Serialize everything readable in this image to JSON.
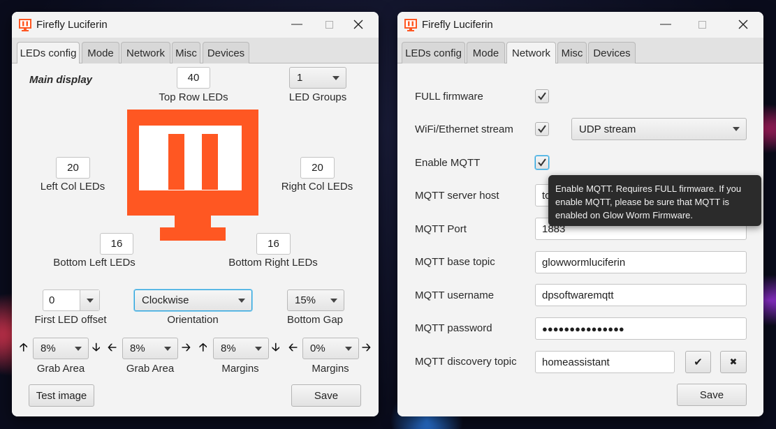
{
  "colors": {
    "brand": "#ff5722",
    "accent": "#2aa3dc"
  },
  "left_window": {
    "title": "Firefly Luciferin",
    "tabs": [
      "LEDs config",
      "Mode",
      "Network",
      "Misc",
      "Devices"
    ],
    "active_tab": "LEDs config",
    "main_display": "Main display",
    "top_row_leds": {
      "value": "40",
      "label": "Top Row LEDs"
    },
    "led_groups": {
      "value": "1",
      "label": "LED Groups"
    },
    "left_col_leds": {
      "value": "20",
      "label": "Left Col LEDs"
    },
    "right_col_leds": {
      "value": "20",
      "label": "Right Col LEDs"
    },
    "bottom_left_leds": {
      "value": "16",
      "label": "Bottom Left LEDs"
    },
    "bottom_right_leds": {
      "value": "16",
      "label": "Bottom Right LEDs"
    },
    "first_led_offset": {
      "value": "0",
      "label": "First LED offset"
    },
    "orientation": {
      "value": "Clockwise",
      "label": "Orientation"
    },
    "bottom_gap": {
      "value": "15%",
      "label": "Bottom Gap"
    },
    "grab_area_top": {
      "value": "8%",
      "label": "Grab Area"
    },
    "grab_area_left": {
      "value": "8%",
      "label": "Grab Area"
    },
    "margins_top": {
      "value": "8%",
      "label": "Margins"
    },
    "margins_left": {
      "value": "0%",
      "label": "Margins"
    },
    "arrows": {
      "up": "🡡",
      "down": "🡣",
      "left": "🡠",
      "right": "🡢"
    },
    "test_image_button": "Test image",
    "save_button": "Save"
  },
  "right_window": {
    "title": "Firefly Luciferin",
    "tabs": [
      "LEDs config",
      "Mode",
      "Network",
      "Misc",
      "Devices"
    ],
    "active_tab": "Network",
    "full_firmware_label": "FULL firmware",
    "full_firmware_checked": true,
    "wifi_stream_label": "WiFi/Ethernet stream",
    "wifi_stream_checked": true,
    "stream_type": "UDP stream",
    "enable_mqtt_label": "Enable MQTT",
    "enable_mqtt_checked": true,
    "mqtt_server_host_label": "MQTT server host",
    "mqtt_server_host_value": "tc",
    "mqtt_port_label": "MQTT Port",
    "mqtt_port_value": "1883",
    "mqtt_base_topic_label": "MQTT base topic",
    "mqtt_base_topic_value": "glowwormluciferin",
    "mqtt_username_label": "MQTT username",
    "mqtt_username_value": "dpsoftwaremqtt",
    "mqtt_password_label": "MQTT password",
    "mqtt_password_value": "●●●●●●●●●●●●●●●",
    "mqtt_discovery_topic_label": "MQTT discovery topic",
    "mqtt_discovery_topic_value": "homeassistant",
    "confirm_button": "✔",
    "clear_button": "✖",
    "save_button": "Save",
    "tooltip": "Enable MQTT. Requires FULL firmware. If you enable MQTT, please be sure that MQTT is enabled on Glow Worm Firmware."
  }
}
